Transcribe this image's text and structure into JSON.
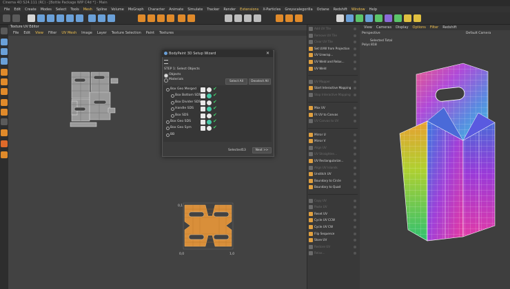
{
  "titlebar": {
    "text": "Cinema 4D S24.111 (RC) - [Bottle Package WIP C4d *] - Main"
  },
  "menubar": {
    "items": [
      {
        "label": "File",
        "hl": false
      },
      {
        "label": "Edit",
        "hl": false
      },
      {
        "label": "Create",
        "hl": false
      },
      {
        "label": "Modes",
        "hl": false
      },
      {
        "label": "Select",
        "hl": false
      },
      {
        "label": "Tools",
        "hl": false
      },
      {
        "label": "Mesh",
        "hl": true
      },
      {
        "label": "Spline",
        "hl": false
      },
      {
        "label": "Volume",
        "hl": false
      },
      {
        "label": "MoGraph",
        "hl": false
      },
      {
        "label": "Character",
        "hl": false
      },
      {
        "label": "Animate",
        "hl": false
      },
      {
        "label": "Simulate",
        "hl": false
      },
      {
        "label": "Tracker",
        "hl": false
      },
      {
        "label": "Render",
        "hl": false
      },
      {
        "label": "Extensions",
        "hl": true
      },
      {
        "label": "X-Particles",
        "hl": false
      },
      {
        "label": "Greyscalegorilla",
        "hl": false
      },
      {
        "label": "Octane",
        "hl": false
      },
      {
        "label": "Redshift",
        "hl": false
      },
      {
        "label": "Window",
        "hl": true
      },
      {
        "label": "Help",
        "hl": false
      }
    ]
  },
  "uv_editor": {
    "tab_label": "Texture UV Editor",
    "menu": [
      {
        "label": "File",
        "hl": false
      },
      {
        "label": "Edit",
        "hl": false
      },
      {
        "label": "View",
        "hl": true
      },
      {
        "label": "Filter",
        "hl": false
      },
      {
        "label": "UV Mesh",
        "hl": true
      },
      {
        "label": "Image",
        "hl": false
      },
      {
        "label": "Layer",
        "hl": false
      },
      {
        "label": "Texture Selection",
        "hl": false
      },
      {
        "label": "Paint",
        "hl": false
      },
      {
        "label": "Textures",
        "hl": false
      }
    ],
    "axis": {
      "y_top": "0,1",
      "x_left": "0,0",
      "x_right": "1,0"
    }
  },
  "dialog": {
    "title": "BodyPaint 3D Setup Wizard",
    "step": "STEP 1: Select Objects",
    "option_objects": "Objects",
    "option_materials": "Materials",
    "select_all": "Select All",
    "deselect_all": "Deselect All",
    "objects": [
      {
        "name": "Box Geo Merged",
        "indent": 0
      },
      {
        "name": "Box Bottom SDS",
        "indent": 1
      },
      {
        "name": "Box Divider SDS",
        "indent": 1
      },
      {
        "name": "Handle SDS",
        "indent": 1
      },
      {
        "name": "Box SDS",
        "indent": 1
      },
      {
        "name": "Box Geo SDS",
        "indent": 0
      },
      {
        "name": "Box Geo Sym",
        "indent": 0
      },
      {
        "name": "BB",
        "indent": 0
      }
    ],
    "selected_label": "Selected:",
    "selected_count": "13",
    "next": "Next >>"
  },
  "commands": [
    {
      "label": "Add UV Tile",
      "disabled": true,
      "color": "#6a6a6a"
    },
    {
      "label": "Remove UV Tile",
      "disabled": true,
      "color": "#6a6a6a"
    },
    {
      "label": "Clear UV Tile",
      "disabled": true,
      "color": "#6a6a6a"
    },
    {
      "label": "Set UVW from Projection",
      "disabled": false,
      "color": "#e0a040"
    },
    {
      "label": "UV Unwrap...",
      "disabled": false,
      "color": "#e0a040"
    },
    {
      "label": "UV Weld and Relax...",
      "disabled": false,
      "color": "#e0a040"
    },
    {
      "label": "UV Weld",
      "disabled": false,
      "color": "#e0a040"
    },
    {
      "label": "",
      "disabled": true,
      "color": "#393939"
    },
    {
      "label": "UV Mapper",
      "disabled": true,
      "color": "#6a6a6a"
    },
    {
      "label": "Start Interactive Mapping",
      "disabled": false,
      "color": "#e0a040"
    },
    {
      "label": "Stop Interactive Mapping",
      "disabled": true,
      "color": "#6a6a6a"
    },
    {
      "label": "",
      "disabled": true,
      "color": "#393939"
    },
    {
      "label": "Max UV",
      "disabled": false,
      "color": "#e0a040"
    },
    {
      "label": "Fit UV to Canvas",
      "disabled": false,
      "color": "#e0a040"
    },
    {
      "label": "UV Canvas to UV",
      "disabled": true,
      "color": "#6a6a6a"
    },
    {
      "label": "",
      "disabled": true,
      "color": "#393939"
    },
    {
      "label": "Mirror U",
      "disabled": false,
      "color": "#e0a040"
    },
    {
      "label": "Mirror V",
      "disabled": false,
      "color": "#e0a040"
    },
    {
      "label": "Align UV",
      "disabled": true,
      "color": "#6a6a6a"
    },
    {
      "label": "UV Straighten...",
      "disabled": true,
      "color": "#6a6a6a"
    },
    {
      "label": "UV Rectangularize...",
      "disabled": false,
      "color": "#e0a040"
    },
    {
      "label": "Align UV Islands",
      "disabled": true,
      "color": "#6a6a6a"
    },
    {
      "label": "Unstitch UV",
      "disabled": false,
      "color": "#e0a040"
    },
    {
      "label": "Boundary to Circle",
      "disabled": false,
      "color": "#e0a040"
    },
    {
      "label": "Boundary to Quad",
      "disabled": false,
      "color": "#e0a040"
    },
    {
      "label": "",
      "disabled": true,
      "color": "#393939"
    },
    {
      "label": "Copy UV",
      "disabled": true,
      "color": "#6a6a6a"
    },
    {
      "label": "Paste UV",
      "disabled": true,
      "color": "#6a6a6a"
    },
    {
      "label": "Reset UV",
      "disabled": false,
      "color": "#e0a040"
    },
    {
      "label": "Cycle UV CCW",
      "disabled": false,
      "color": "#e0a040"
    },
    {
      "label": "Cycle UV CW",
      "disabled": false,
      "color": "#e0a040"
    },
    {
      "label": "Flip Sequence",
      "disabled": false,
      "color": "#e0a040"
    },
    {
      "label": "Store UV",
      "disabled": false,
      "color": "#e0a040"
    },
    {
      "label": "Restore UV",
      "disabled": true,
      "color": "#6a6a6a"
    },
    {
      "label": "Relax...",
      "disabled": true,
      "color": "#6a6a6a"
    }
  ],
  "viewport": {
    "menu": [
      {
        "label": "View",
        "hl": false
      },
      {
        "label": "Cameras",
        "hl": false
      },
      {
        "label": "Display",
        "hl": false
      },
      {
        "label": "Options",
        "hl": true
      },
      {
        "label": "Filter",
        "hl": true
      },
      {
        "label": "Redshift",
        "hl": false
      }
    ],
    "view_name": "Perspective",
    "camera_name": "Default Camera",
    "selected_total": "Selected Total",
    "polys_label": "Polys",
    "polys_value": "818"
  },
  "colors": {
    "accent": "#f2c24f",
    "uv_orange": "#d98f3a",
    "check": "#3fd06a"
  }
}
